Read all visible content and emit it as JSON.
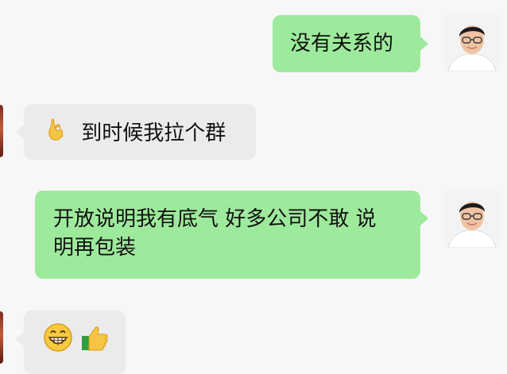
{
  "messages": [
    {
      "side": "sent",
      "text": "没有关系的"
    },
    {
      "side": "received",
      "text": "到时候我拉个群",
      "icon": "ok-hand-icon"
    },
    {
      "side": "sent",
      "line1": "开放说明我有底气 好多公司不敢 说",
      "line2": "明再包装"
    },
    {
      "side": "received",
      "icons": [
        "grinning-face-icon",
        "thumbs-up-icon"
      ]
    }
  ],
  "colors": {
    "background": "#f7f7f7",
    "sent_bubble": "#9eea9c",
    "received_bubble": "#ebebeb"
  }
}
